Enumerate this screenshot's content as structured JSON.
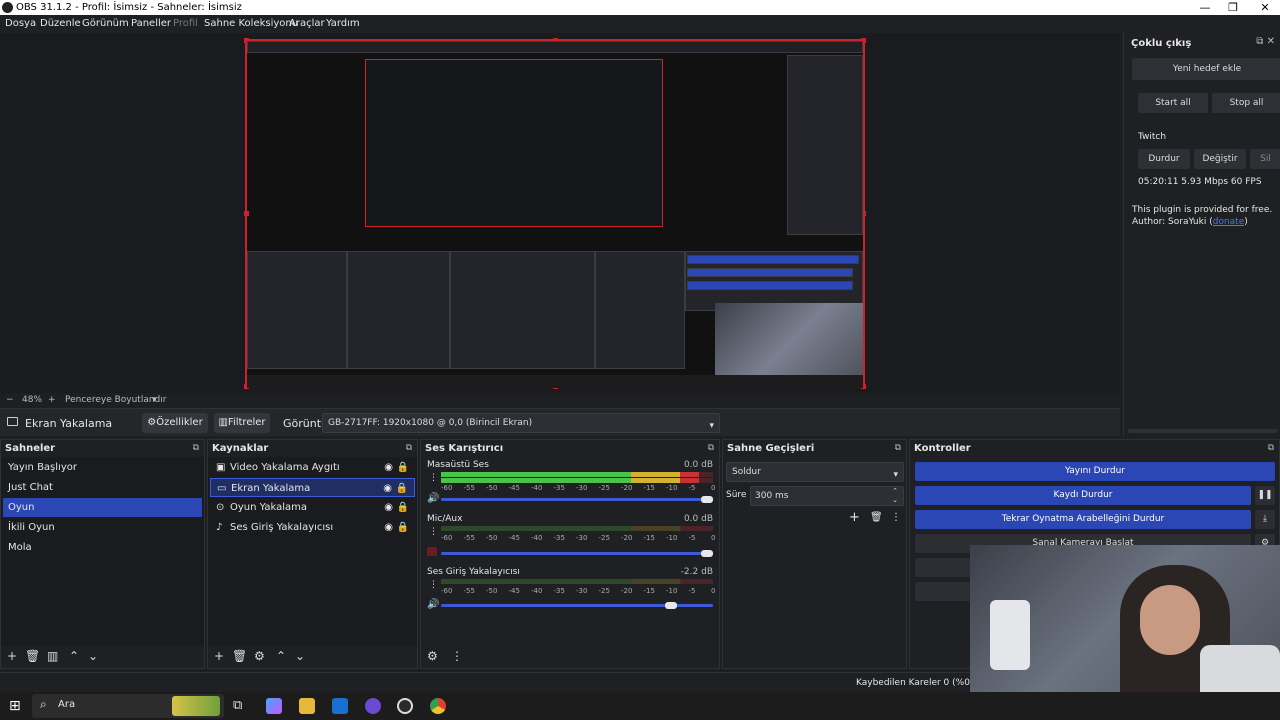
{
  "window": {
    "title": "OBS 31.1.2 - Profil: İsimsiz - Sahneler: İsimsiz",
    "controls": [
      "—",
      "❐",
      "✕"
    ]
  },
  "menu": {
    "items": [
      "Dosya",
      "Düzenle",
      "Görünüm",
      "Paneller",
      "Profil",
      "Sahne Koleksiyonu",
      "Araçlar",
      "Yardım"
    ]
  },
  "zoom": {
    "minus": "−",
    "value": "48%",
    "plus": "+",
    "fit": "Pencereye Boyutlandır"
  },
  "source_bar": {
    "source_name": "Ekran Yakalama",
    "properties": "Özellikler",
    "filters": "Filtreler",
    "display_label": "Görüntü",
    "display_value": "GB-2717FF: 1920x1080 @ 0,0 (Birincil Ekran)"
  },
  "multistream": {
    "title": "Çoklu çıkış",
    "add_target": "Yeni hedef ekle",
    "start_all": "Start all",
    "stop_all": "Stop all",
    "target_name": "Twitch",
    "stop": "Durdur",
    "edit": "Değiştir",
    "delete": "Sil",
    "stats": "05:20:11  5.93 Mbps  60 FPS",
    "note1": "This plugin is provided for free.",
    "note2_prefix": "Author: SoraYuki (",
    "note2_link": "donate",
    "note2_suffix": ")"
  },
  "scenes": {
    "title": "Sahneler",
    "items": [
      "Yayın Başlıyor",
      "Just Chat",
      "Oyun",
      "İkili Oyun",
      "Mola"
    ],
    "selected_index": 2
  },
  "sources": {
    "title": "Kaynaklar",
    "items": [
      "Video Yakalama Aygıtı",
      "Ekran Yakalama",
      "Oyun Yakalama",
      "Ses Giriş Yakalayıcısı"
    ],
    "selected_index": 1
  },
  "mixer": {
    "title": "Ses Karıştırıcı",
    "ticks": [
      "-60",
      "-55",
      "-50",
      "-45",
      "-40",
      "-35",
      "-30",
      "-25",
      "-20",
      "-15",
      "-10",
      "-5",
      "0"
    ],
    "channels": [
      {
        "name": "Masaüstü Ses",
        "db": "0.0 dB",
        "level": 0.95,
        "volume": 1.0
      },
      {
        "name": "Mic/Aux",
        "db": "0.0 dB",
        "level": 0.0,
        "volume": 1.0
      },
      {
        "name": "Ses Giriş Yakalayıcısı",
        "db": "-2.2 dB",
        "level": 0.0,
        "volume": 0.86
      }
    ]
  },
  "transitions": {
    "title": "Sahne Geçişleri",
    "type": "Soldur",
    "duration_label": "Süre",
    "duration_value": "300 ms"
  },
  "controls": {
    "title": "Kontroller",
    "stream": "Yayını Durdur",
    "record": "Kaydı Durdur",
    "replay": "Tekrar Oynatma Arabelleğini Durdur",
    "virtualcam": "Sanal Kamerayı Başlat"
  },
  "status": {
    "dropped": "Kaybedilen Kareler 0 (%0.0)"
  },
  "taskbar": {
    "search": "Ara"
  },
  "colors": {
    "accent": "#2b47b5",
    "selection_outline": "#d0202a",
    "meter_green": "#4bc34b",
    "meter_yellow": "#d2b232",
    "meter_red": "#c83232"
  }
}
